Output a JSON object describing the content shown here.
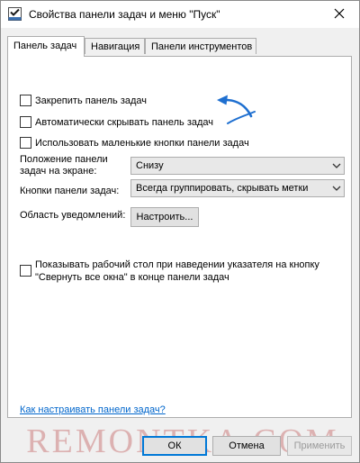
{
  "window": {
    "title": "Свойства панели задач и меню \"Пуск\"",
    "icon": "taskbar-properties-icon",
    "close_icon": "close-icon"
  },
  "tabs": [
    {
      "label": "Панель задач",
      "active": true
    },
    {
      "label": "Навигация",
      "active": false
    },
    {
      "label": "Панели инструментов",
      "active": false
    }
  ],
  "checkboxes": {
    "lock_taskbar": {
      "label": "Закрепить панель задач",
      "checked": false
    },
    "autohide": {
      "label": "Автоматически скрывать панель задач",
      "checked": false
    },
    "small_buttons": {
      "label": "Использовать маленькие кнопки панели задач",
      "checked": false
    },
    "peek_line1": "Показывать рабочий стол при наведении указателя на кнопку",
    "peek_line2": "\"Свернуть все окна\" в конце панели задач",
    "peek_checked": false
  },
  "position": {
    "label_line1": "Положение панели",
    "label_line2": "задач на экране:",
    "value": "Снизу"
  },
  "buttons_combine": {
    "label": "Кнопки панели задач:",
    "value": "Всегда группировать, скрывать метки"
  },
  "notification_area": {
    "label": "Область уведомлений:",
    "button": "Настроить..."
  },
  "help_link": "Как настраивать панели задач?",
  "footer": {
    "ok": "ОК",
    "cancel": "Отмена",
    "apply": "Применить"
  },
  "watermark": "REMONTKA.COM",
  "colors": {
    "arrow": "#1e6fd0",
    "link": "#0066cc",
    "accent": "#0078d7",
    "watermark": "#b02222"
  }
}
